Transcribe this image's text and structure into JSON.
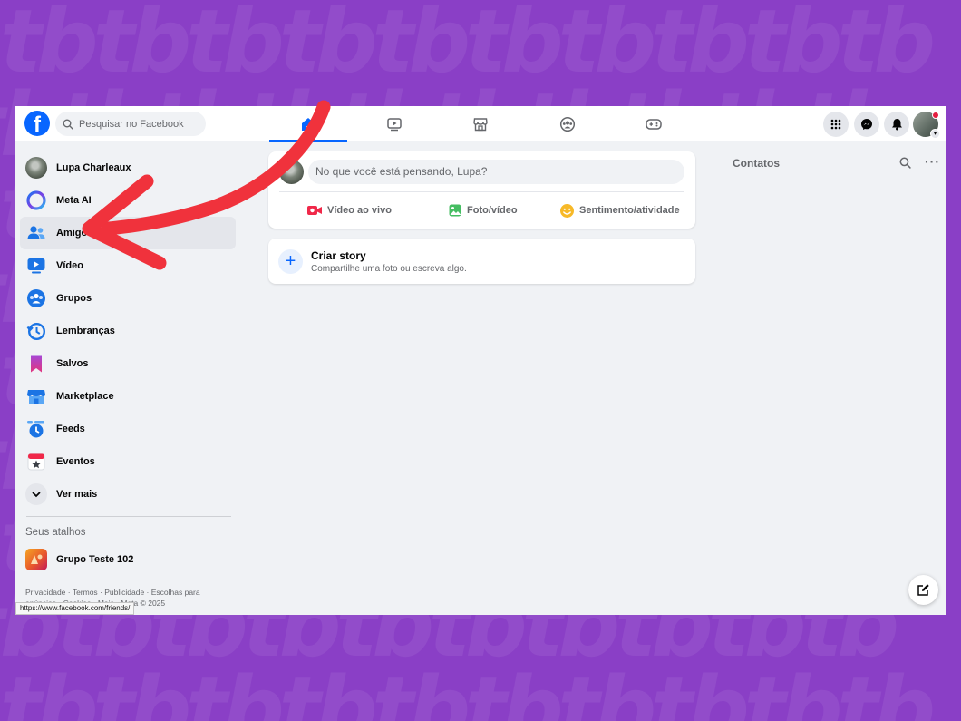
{
  "search": {
    "placeholder": "Pesquisar no Facebook"
  },
  "nav_tabs": [
    {
      "name": "home",
      "active": true
    },
    {
      "name": "video",
      "active": false
    },
    {
      "name": "marketplace",
      "active": false
    },
    {
      "name": "groups",
      "active": false
    },
    {
      "name": "gaming",
      "active": false
    }
  ],
  "sidebar": {
    "items": [
      {
        "label": "Lupa Charleaux",
        "icon": "profile-avatar"
      },
      {
        "label": "Meta AI",
        "icon": "meta-ai-icon"
      },
      {
        "label": "Amigos",
        "icon": "friends-icon"
      },
      {
        "label": "Vídeo",
        "icon": "video-icon"
      },
      {
        "label": "Grupos",
        "icon": "groups-icon"
      },
      {
        "label": "Lembranças",
        "icon": "memories-icon"
      },
      {
        "label": "Salvos",
        "icon": "saved-icon"
      },
      {
        "label": "Marketplace",
        "icon": "marketplace-icon"
      },
      {
        "label": "Feeds",
        "icon": "feeds-icon"
      },
      {
        "label": "Eventos",
        "icon": "events-icon"
      },
      {
        "label": "Ver mais",
        "icon": "chevron-down-icon"
      }
    ],
    "shortcuts_title": "Seus atalhos",
    "shortcuts": [
      {
        "label": "Grupo Teste 102"
      }
    ],
    "footer": "Privacidade · Termos · Publicidade · Escolhas para anúncios · Cookies · Mais · Meta © 2025",
    "status_url": "https://www.facebook.com/friends/"
  },
  "composer": {
    "placeholder": "No que você está pensando, Lupa?",
    "actions": [
      {
        "label": "Vídeo ao vivo",
        "color": "#f02849"
      },
      {
        "label": "Foto/vídeo",
        "color": "#45bd62"
      },
      {
        "label": "Sentimento/atividade",
        "color": "#f7b928"
      }
    ]
  },
  "story": {
    "title": "Criar story",
    "subtitle": "Compartilhe uma foto ou escreva algo."
  },
  "contacts": {
    "title": "Contatos"
  },
  "colors": {
    "brand": "#0866ff",
    "background": "#8a3fc6",
    "annotation_arrow": "#f0323c"
  }
}
